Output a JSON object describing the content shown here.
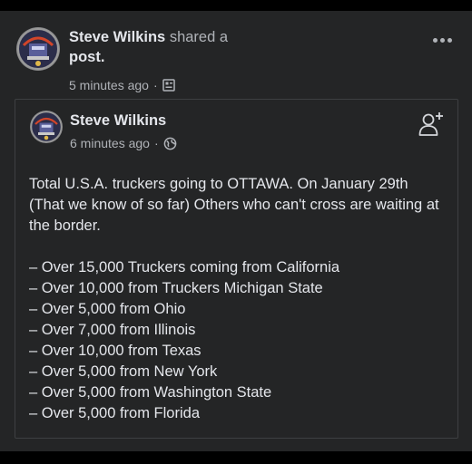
{
  "outer_post": {
    "author": "Steve Wilkins",
    "action": "shared a",
    "object": "post.",
    "timestamp": "5 minutes ago",
    "separator": "·",
    "audience_icon": "custom-audience-icon"
  },
  "shared_post": {
    "author": "Steve Wilkins",
    "timestamp": "6 minutes ago",
    "separator": "·",
    "audience_icon": "globe-icon",
    "intro": "Total U.S.A. truckers going to OTTAWA. On January 29th (That we know of so far) Others who can't cross are waiting at the border.",
    "items": [
      "– Over 15,000 Truckers coming from California",
      "– Over 10,000 from Truckers Michigan State",
      "– Over 5,000 from Ohio",
      "– Over 7,000 from Illinois",
      "– Over 10,000 from Texas",
      "– Over 5,000 from New York",
      "– Over 5,000 from Washington State",
      "– Over 5,000 from Florida"
    ]
  },
  "icons": {
    "more": "more-options-icon",
    "add_friend": "add-friend-icon"
  },
  "colors": {
    "background": "#000000",
    "card": "#242526",
    "primary_text": "#e4e6eb",
    "secondary_text": "#b0b3b8",
    "border": "#3e4042"
  }
}
